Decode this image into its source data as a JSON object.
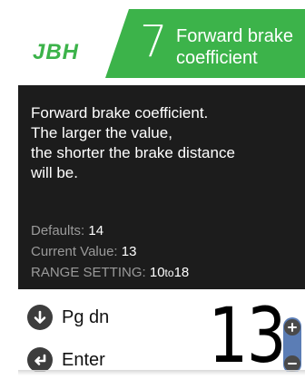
{
  "header": {
    "logo": "JBH",
    "param_number": "7",
    "param_title_line1": "Forward brake",
    "param_title_line2": "coefficient",
    "accent_color": "#3cb34a"
  },
  "description": {
    "line1": "Forward brake coefficient.",
    "line2": "The larger the value,",
    "line3": "the shorter the brake distance",
    "line4": "will be."
  },
  "info": {
    "defaults_label": "Defaults:",
    "defaults_value": "14",
    "current_label": "Current Value:",
    "current_value": "13",
    "range_label": "RANGE SETTING:",
    "range_min": "10",
    "range_to": "to",
    "range_max": "18"
  },
  "controls": {
    "pgdn_label": "Pg dn",
    "pgdn_icon": "arrow-down-icon",
    "enter_label": "Enter",
    "enter_icon": "enter-return-icon"
  },
  "value_display": {
    "value": "13",
    "stepper_color": "#5b7db5"
  }
}
